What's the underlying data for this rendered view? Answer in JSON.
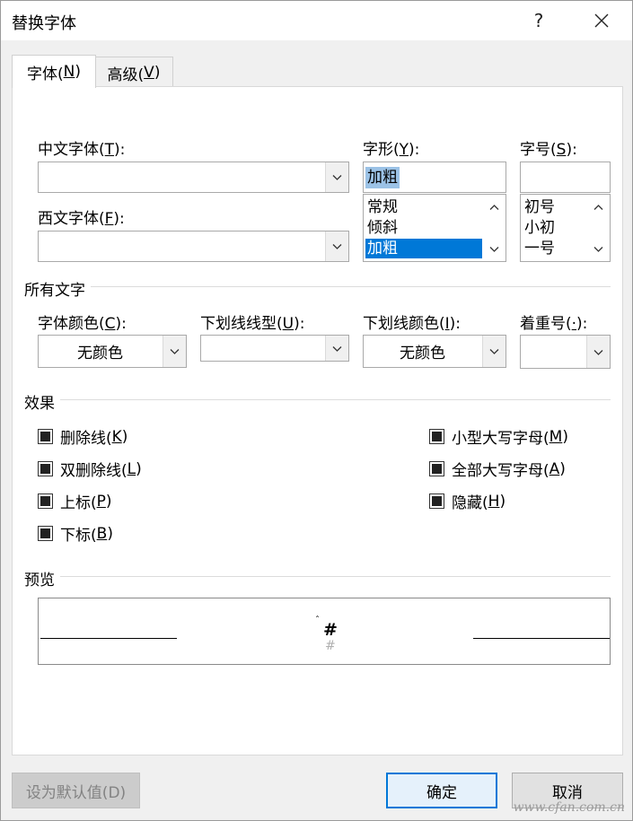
{
  "window": {
    "title": "替换字体",
    "help_glyph": "?",
    "close_glyph": "✕"
  },
  "tabs": [
    {
      "label_pre": "字体(",
      "key": "N",
      "label_post": ")",
      "active": true
    },
    {
      "label_pre": "高级(",
      "key": "V",
      "label_post": ")",
      "active": false
    }
  ],
  "font": {
    "chinese_font": {
      "label_pre": "中文字体(",
      "key": "T",
      "label_post": "):",
      "value": ""
    },
    "western_font": {
      "label_pre": "西文字体(",
      "key": "F",
      "label_post": "):",
      "value": ""
    },
    "style": {
      "label_pre": "字形(",
      "key": "Y",
      "label_post": "):",
      "value": "加粗",
      "options": [
        "常规",
        "倾斜",
        "加粗"
      ],
      "selected": "加粗"
    },
    "size": {
      "label_pre": "字号(",
      "key": "S",
      "label_post": "):",
      "value": "",
      "options": [
        "初号",
        "小初",
        "一号"
      ]
    }
  },
  "all_text": {
    "section_label": "所有文字",
    "font_color": {
      "label_pre": "字体颜色(",
      "key": "C",
      "label_post": "):",
      "value": "无颜色"
    },
    "underline_style": {
      "label_pre": "下划线线型(",
      "key": "U",
      "label_post": "):",
      "value": ""
    },
    "underline_color": {
      "label_pre": "下划线颜色(",
      "key": "I",
      "label_post": "):",
      "value": "无颜色"
    },
    "emphasis_mark": {
      "label_pre": "着重号(",
      "key": "·",
      "label_post": "):",
      "value": ""
    }
  },
  "effects": {
    "section_label": "效果",
    "items": [
      {
        "label_pre": "删除线(",
        "key": "K",
        "label_post": ")",
        "state": "indeterminate"
      },
      {
        "label_pre": "双删除线(",
        "key": "L",
        "label_post": ")",
        "state": "indeterminate"
      },
      {
        "label_pre": "上标(",
        "key": "P",
        "label_post": ")",
        "state": "indeterminate"
      },
      {
        "label_pre": "下标(",
        "key": "B",
        "label_post": ")",
        "state": "indeterminate"
      },
      {
        "label_pre": "小型大写字母(",
        "key": "M",
        "label_post": ")",
        "state": "indeterminate"
      },
      {
        "label_pre": "全部大写字母(",
        "key": "A",
        "label_post": ")",
        "state": "indeterminate"
      },
      {
        "label_pre": "隐藏(",
        "key": "H",
        "label_post": ")",
        "state": "indeterminate"
      }
    ]
  },
  "preview": {
    "section_label": "预览",
    "sample_text": "#",
    "sample_shadow": "#"
  },
  "buttons": {
    "set_default": "设为默认值(D)",
    "ok": "确定",
    "cancel": "取消"
  },
  "watermark": "www.cfan.com.cn",
  "colors": {
    "selection": "#0078d7",
    "dialog_bg": "#f0f0f0",
    "default_button_border": "#0078d7"
  }
}
